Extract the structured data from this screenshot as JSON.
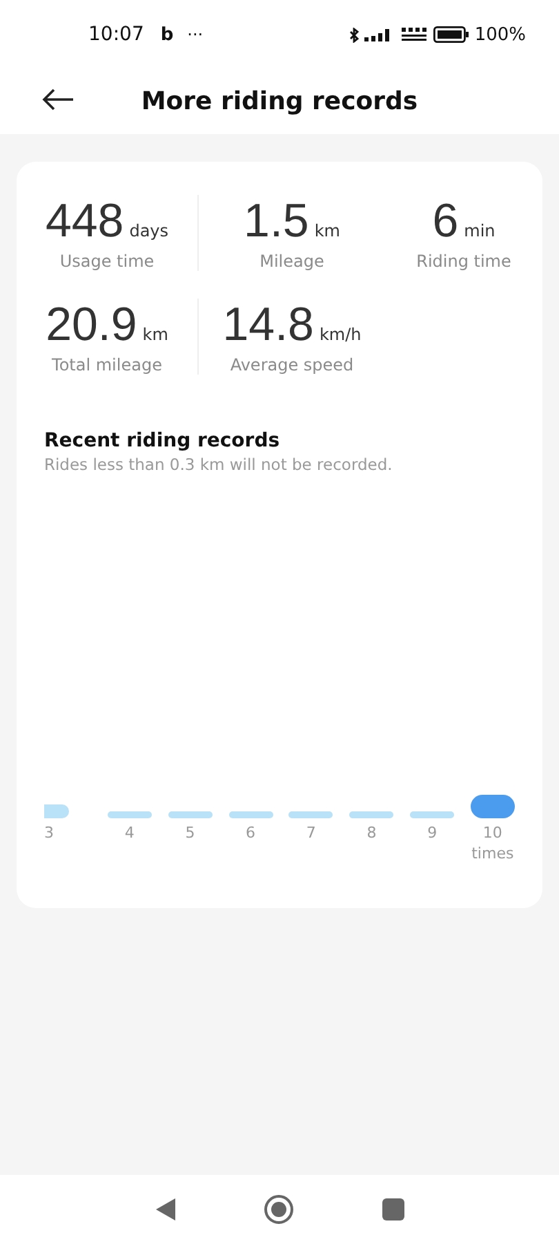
{
  "status_bar": {
    "time": "10:07",
    "app_badge": "b",
    "more": "···",
    "battery": "100%"
  },
  "header": {
    "title": "More riding records"
  },
  "stats": [
    {
      "value": "448",
      "unit": "days",
      "label": "Usage time"
    },
    {
      "value": "1.5",
      "unit": "km",
      "label": "Mileage"
    },
    {
      "value": "6",
      "unit": "min",
      "label": "Riding time"
    },
    {
      "value": "20.9",
      "unit": "km",
      "label": "Total mileage"
    },
    {
      "value": "14.8",
      "unit": "km/h",
      "label": "Average speed"
    }
  ],
  "recent": {
    "title": "Recent riding records",
    "note": "Rides less than 0.3 km will not be recorded.",
    "bars": [
      {
        "label": "3",
        "selected": false
      },
      {
        "label": "4",
        "selected": false
      },
      {
        "label": "5",
        "selected": false
      },
      {
        "label": "6",
        "selected": false
      },
      {
        "label": "7",
        "selected": false
      },
      {
        "label": "8",
        "selected": false
      },
      {
        "label": "9",
        "selected": false
      },
      {
        "label": "10 times",
        "selected": true
      }
    ]
  }
}
